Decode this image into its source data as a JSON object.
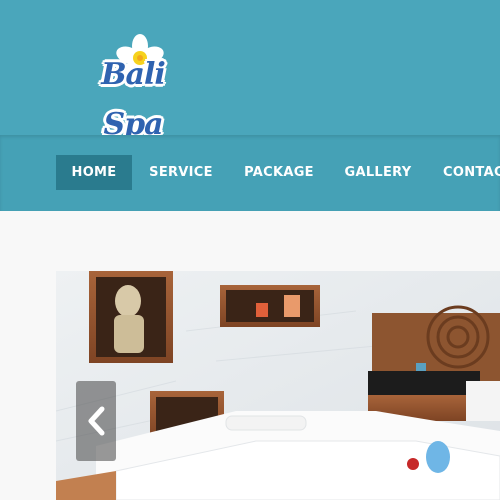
{
  "brand": {
    "logo_text": "Bali Spa",
    "logo_icon": "frangipani-flower-icon"
  },
  "nav": {
    "items": [
      {
        "label": "HOME",
        "active": true
      },
      {
        "label": "SERVICE",
        "active": false
      },
      {
        "label": "PACKAGE",
        "active": false
      },
      {
        "label": "GALLERY",
        "active": false
      },
      {
        "label": "CONTACT",
        "active": false
      }
    ]
  },
  "slider": {
    "image_alt": "spa-room-photo",
    "prev_icon": "chevron-left-icon"
  },
  "colors": {
    "header_bg": "#4aa6bb",
    "nav_bg": "#45a1b6",
    "nav_active": "#2a7b8e",
    "logo_blue": "#2f63b0"
  }
}
